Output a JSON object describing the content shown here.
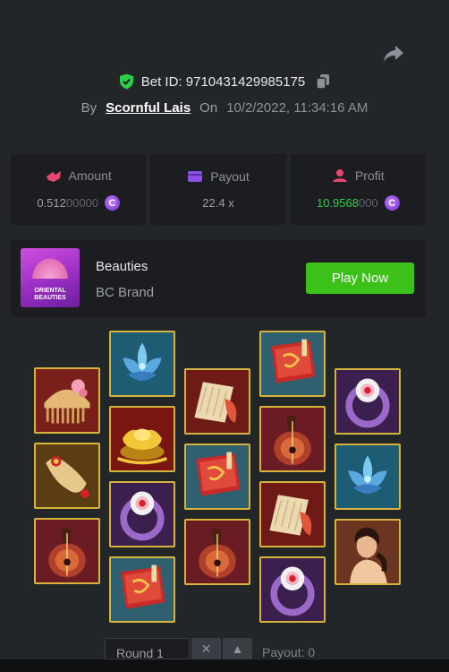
{
  "header": {
    "bet_id_label": "Bet ID: 9710431429985175",
    "by_label": "By",
    "username": "Scornful Lais",
    "on_label": "On",
    "date": "10/2/2022, 11:34:16 AM"
  },
  "stats": {
    "amount": {
      "label": "Amount",
      "value_main": "0.512",
      "value_dim": "00000"
    },
    "payout": {
      "label": "Payout",
      "value": "22.4 x"
    },
    "profit": {
      "label": "Profit",
      "value_main": "10.9568",
      "value_dim": "000"
    },
    "coin_glyph": "C"
  },
  "game": {
    "thumb_text": "ORIENTAL BEAUTIES",
    "title": "Beauties",
    "brand": "BC Brand",
    "play_label": "Play Now"
  },
  "reels": [
    [
      "comb",
      "scroll",
      "pipa"
    ],
    [
      "lotus",
      "gold",
      "ring",
      "book"
    ],
    [
      "fan",
      "book",
      "pipa"
    ],
    [
      "book",
      "pipa",
      "fan",
      "ring"
    ],
    [
      "ring",
      "lotus",
      "lady"
    ]
  ],
  "round": {
    "label": "Round 1",
    "payout_label": "Payout: 0"
  },
  "colors": {
    "background": "#232629",
    "panel": "#1b1d20",
    "play_button": "#3bc117",
    "profit_green": "#2dcf46",
    "tile_border": "#d6b43c",
    "coin": "#9b4fe8"
  },
  "icons": {
    "share": "share-icon",
    "shield": "shield-check-icon",
    "copy": "copy-icon",
    "amount": "amount-icon",
    "payout": "wallet-icon",
    "profit": "profit-icon"
  }
}
